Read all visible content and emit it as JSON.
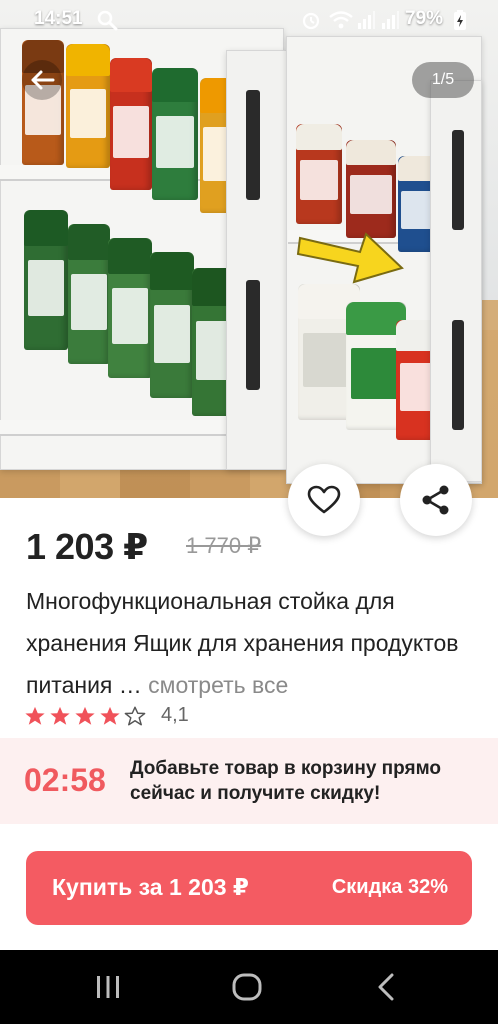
{
  "status_bar": {
    "time": "14:51",
    "battery": "79%"
  },
  "gallery": {
    "counter": "1/5"
  },
  "product": {
    "price": "1 203 ₽",
    "old_price": "1 770 ₽",
    "title": "Многофункциональная стойка для хранения Ящик для хранения продуктов питания …",
    "see_all": "смотреть все",
    "rating_value": "4,1",
    "stars_filled": 4,
    "stars_total": 5
  },
  "promo": {
    "timer": "02:58",
    "text": "Добавьте товар в корзину прямо сейчас и получите скидку!"
  },
  "buy_button": {
    "label": "Купить за 1 203 ₽",
    "discount": "Скидка 32%"
  },
  "colors": {
    "accent": "#f45b62",
    "timer": "#f05a5f",
    "promo_bg": "#fdf0f0"
  },
  "icons": {
    "back": "arrow-left-icon",
    "favorite": "heart-icon",
    "share": "share-icon",
    "star": "star-icon"
  }
}
